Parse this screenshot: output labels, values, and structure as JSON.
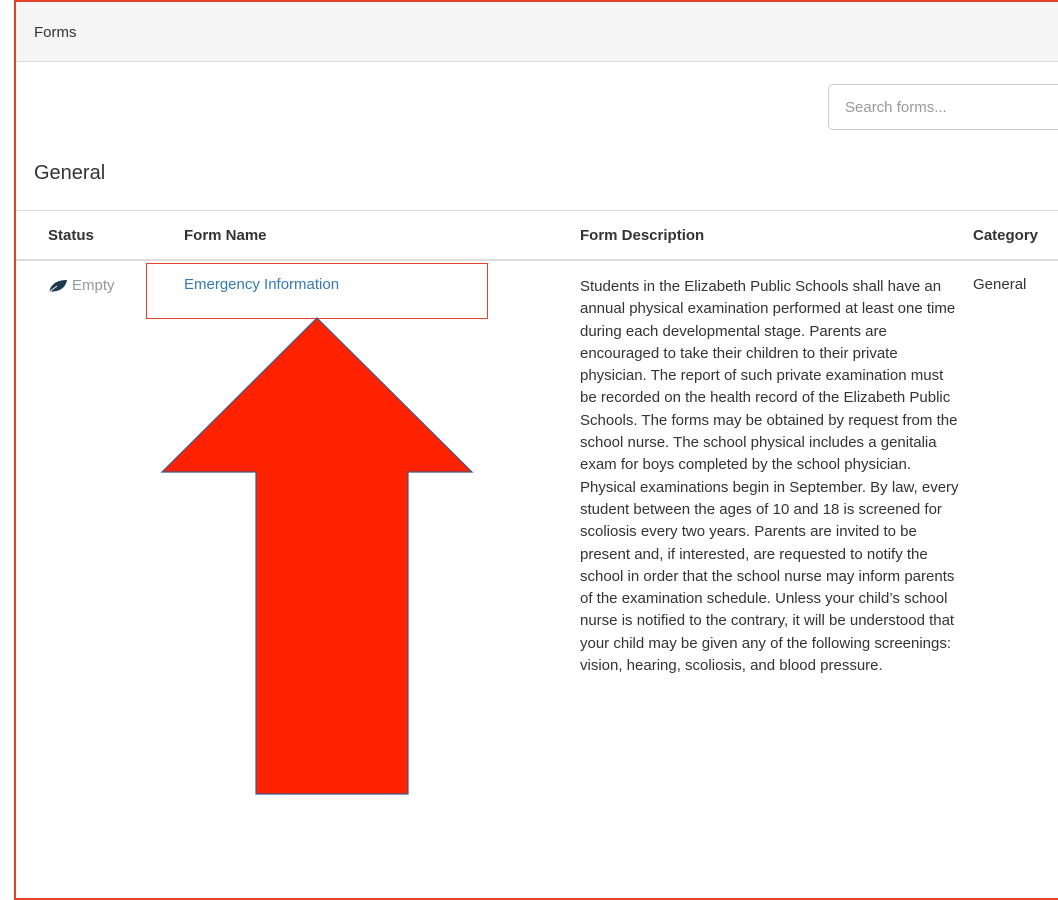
{
  "panel": {
    "title": "Forms"
  },
  "search": {
    "placeholder": "Search forms..."
  },
  "section": {
    "title": "General"
  },
  "table": {
    "headers": {
      "status": "Status",
      "name": "Form Name",
      "description": "Form Description",
      "category": "Category"
    },
    "rows": [
      {
        "status": "Empty",
        "status_icon": "leaf-icon",
        "name": "Emergency Information",
        "description": "Students in the Elizabeth Public Schools shall have an annual physical examination performed at least one time during each developmental stage. Parents are encouraged to take their children to their private physician. The report of such private examination must be recorded on the health record of the Elizabeth Public Schools. The forms may be obtained by request from the school nurse. The school physical includes a genitalia exam for boys completed by the school physician. Physical examinations begin in September. By law, every student between the ages of 10 and 18 is screened for scoliosis every two years. Parents are invited to be present and, if interested, are requested to notify the school in order that the school nurse may inform parents of the examination schedule. Unless your child’s school nurse is notified to the contrary, it will be understood that your child may be given any of the following screenings: vision, hearing, scoliosis, and blood pressure.",
        "category": "General"
      }
    ]
  },
  "annotation": {
    "highlight_color": "#e8402a",
    "arrow_color": "#ff2200"
  }
}
